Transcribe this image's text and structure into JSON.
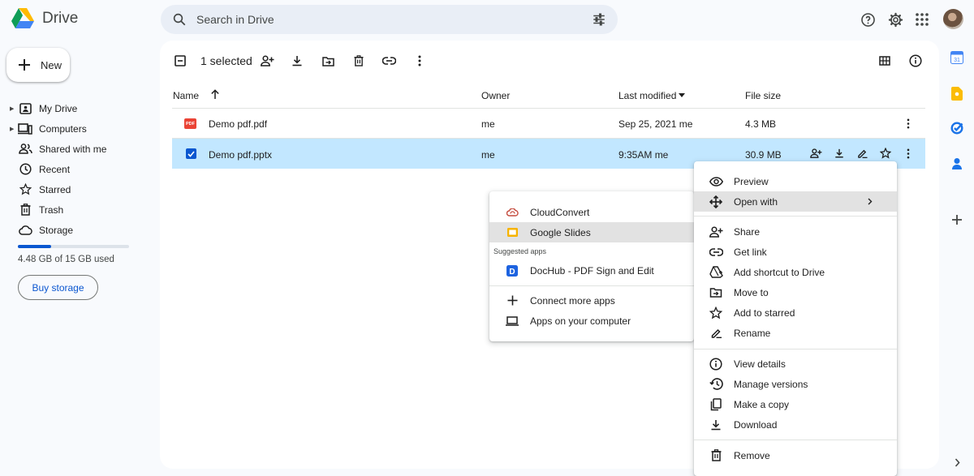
{
  "app": {
    "name": "Drive"
  },
  "search": {
    "placeholder": "Search in Drive"
  },
  "sidebar": {
    "new_label": "New",
    "items": [
      {
        "label": "My Drive",
        "icon": "my-drive-icon"
      },
      {
        "label": "Computers",
        "icon": "computers-icon"
      },
      {
        "label": "Shared with me",
        "icon": "shared-icon"
      },
      {
        "label": "Recent",
        "icon": "recent-icon"
      },
      {
        "label": "Starred",
        "icon": "star-icon"
      },
      {
        "label": "Trash",
        "icon": "trash-icon"
      },
      {
        "label": "Storage",
        "icon": "cloud-icon"
      }
    ],
    "storage_text": "4.48 GB of 15 GB used",
    "storage_used_fraction": 0.299,
    "buy_storage": "Buy storage"
  },
  "toolbar": {
    "selected_text": "1 selected"
  },
  "table": {
    "headers": {
      "name": "Name",
      "owner": "Owner",
      "modified": "Last modified",
      "size": "File size"
    },
    "rows": [
      {
        "name": "Demo pdf.pdf",
        "owner": "me",
        "modified": "Sep 25, 2021 me",
        "size": "4.3 MB",
        "selected": false
      },
      {
        "name": "Demo pdf.pptx",
        "owner": "me",
        "modified": "9:35AM me",
        "size": "30.9 MB",
        "selected": true
      }
    ]
  },
  "context_menu": {
    "items": [
      {
        "label": "Preview",
        "icon": "eye-icon"
      },
      {
        "label": "Open with",
        "icon": "open-with-icon"
      },
      {
        "label": "Share",
        "icon": "share-icon"
      },
      {
        "label": "Get link",
        "icon": "link-icon"
      },
      {
        "label": "Add shortcut to Drive",
        "icon": "add-shortcut-icon"
      },
      {
        "label": "Move to",
        "icon": "move-to-icon"
      },
      {
        "label": "Add to starred",
        "icon": "star-icon"
      },
      {
        "label": "Rename",
        "icon": "rename-icon"
      },
      {
        "label": "View details",
        "icon": "info-icon"
      },
      {
        "label": "Manage versions",
        "icon": "history-icon"
      },
      {
        "label": "Make a copy",
        "icon": "copy-icon"
      },
      {
        "label": "Download",
        "icon": "download-icon"
      },
      {
        "label": "Remove",
        "icon": "trash-icon"
      }
    ]
  },
  "open_with_menu": {
    "items": [
      {
        "label": "CloudConvert",
        "icon": "cloudconvert-icon"
      },
      {
        "label": "Google Slides",
        "icon": "google-slides-icon"
      },
      {
        "label": "DocHub - PDF Sign and Edit",
        "icon": "dochub-icon"
      },
      {
        "label": "Connect more apps",
        "icon": "plus-icon"
      },
      {
        "label": "Apps on your computer",
        "icon": "laptop-icon"
      }
    ],
    "suggested_caption": "Suggested apps"
  },
  "colors": {
    "accent": "#0b57d0",
    "selected_row": "#c2e7ff",
    "background": "#f8fafd"
  }
}
